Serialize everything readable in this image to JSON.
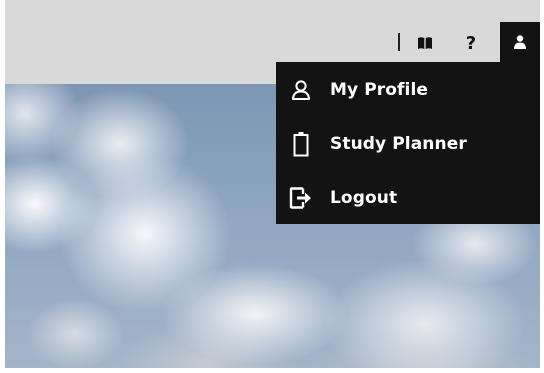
{
  "toolbar": {
    "book_icon": "book-icon",
    "help_label": "?",
    "user_icon": "user-icon"
  },
  "menu": {
    "items": [
      {
        "label": "My Profile",
        "icon": "person-outline-icon"
      },
      {
        "label": "Study Planner",
        "icon": "battery-outline-icon"
      },
      {
        "label": "Logout",
        "icon": "logout-icon"
      }
    ]
  },
  "colors": {
    "topbar": "#d9d9d9",
    "menu_background": "#131313",
    "menu_text": "#ffffff"
  }
}
